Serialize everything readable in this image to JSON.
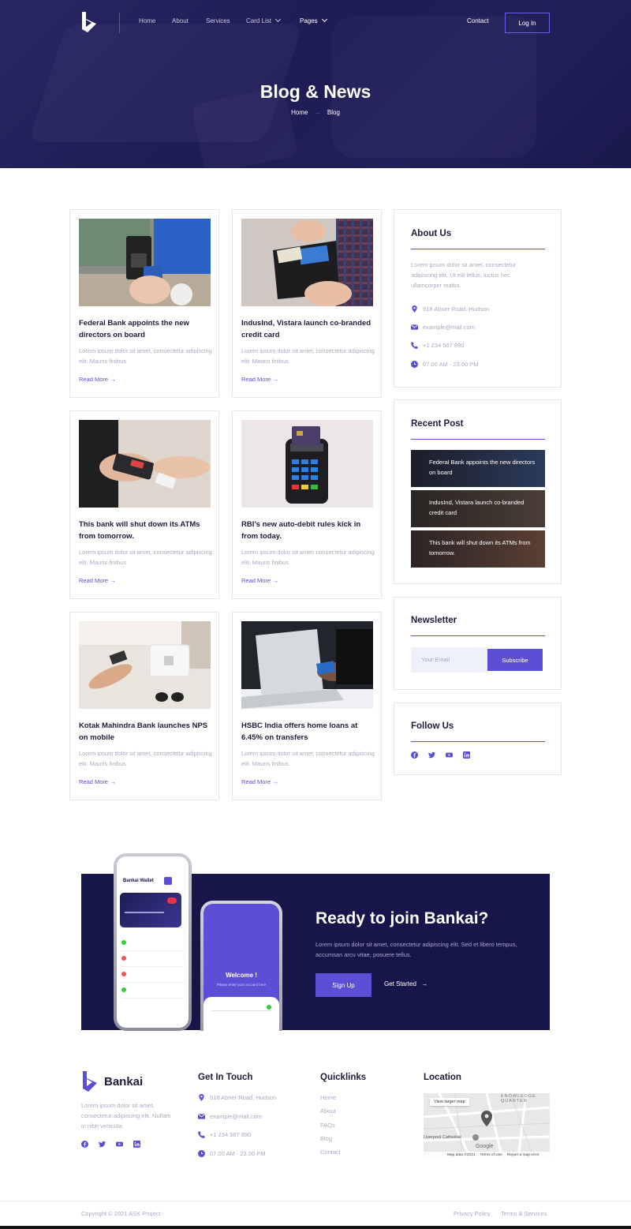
{
  "brand": {
    "name": "Bankai",
    "accent": "#5b4fd6",
    "dark": "#17164a"
  },
  "nav": {
    "items": [
      {
        "label": "Home"
      },
      {
        "label": "About"
      },
      {
        "label": "Services"
      },
      {
        "label": "Card List"
      },
      {
        "label": "Pages"
      }
    ],
    "contact": "Contact",
    "login": "Log In"
  },
  "hero": {
    "title": "Blog & News",
    "crumb_home": "Home",
    "crumb_current": "Blog"
  },
  "posts": [
    {
      "title": "Federal Bank appoints the new directors on board",
      "excerpt": "Lorem ipsum dolor sit amet, consectetur adipiscing elit. Mauris finibus",
      "link": "Read More"
    },
    {
      "title": "IndusInd, Vistara launch co-branded credit card",
      "excerpt": "Lorem ipsum dolor sit amet, consectetur adipiscing elit. Mauris finibus",
      "link": "Read More"
    },
    {
      "title": "This bank will shut down its ATMs from tomorrow.",
      "excerpt": "Lorem ipsum dolor sit amet, consectetur adipiscing elit. Mauris finibus",
      "link": "Read More"
    },
    {
      "title": "RBI’s new auto-debit rules kick in from today.",
      "excerpt": "Lorem ipsum dolor sit amet, consectetur adipiscing elit. Mauris finibus",
      "link": "Read More"
    },
    {
      "title": "Kotak Mahindra Bank launches NPS on mobile",
      "excerpt": "Lorem ipsum dolor sit amet, consectetur adipiscing elit. Mauris finibus",
      "link": "Read More"
    },
    {
      "title": "HSBC India offers home loans at 6.45% on transfers",
      "excerpt": "Lorem ipsum dolor sit amet, consectetur adipiscing elit. Mauris finibus",
      "link": "Read More"
    }
  ],
  "about": {
    "title": "About Us",
    "text": "Lorem ipsum dolor sit amet, consectetur adipiscing elit. Ut elit tellus, luctus nec ullamcorper mattis.",
    "address": "918 Abner Road, Hudson",
    "email": "example@mail.com",
    "phone": "+1 234 567 890",
    "hours": "07.00 AM - 23.00 PM"
  },
  "recent": {
    "title": "Recent Post",
    "items": [
      {
        "text": "Federal Bank appoints the new directors on board"
      },
      {
        "text": "IndusInd, Vistara launch co-branded credit card"
      },
      {
        "text": "This bank will shut down its ATMs from tomorrow."
      }
    ]
  },
  "newsletter": {
    "title": "Newsletter",
    "placeholder": "Your Email",
    "button": "Subscribe"
  },
  "follow": {
    "title": "Follow Us",
    "icons": [
      "facebook-icon",
      "twitter-icon",
      "youtube-icon",
      "linkedin-icon"
    ]
  },
  "cta": {
    "title": "Ready to join Bankai?",
    "text": "Lorem ipsum dolor sit amet, consectetur adipiscing elit. Sed et libero tempus, accumsan arcu vitae, posuere tellus.",
    "signup": "Sign Up",
    "get_started": "Get Started",
    "phone_app_title": "Bankai Wallet",
    "phone_welcome": "Welcome !",
    "phone_welcome_sub": "Please enter your account here"
  },
  "footer": {
    "about_text": "Lorem ipsum dolor sit amet, consectetur adipiscing elit. Nullam in nibh vehicula.",
    "get_in_touch": {
      "title": "Get In Touch",
      "address": "918 Abner Road, Hudson",
      "email": "example@mail.com",
      "phone": "+1 234 567 890",
      "hours": "07.00 AM - 23.00 PM"
    },
    "quicklinks": {
      "title": "Quicklinks",
      "links": [
        "Home",
        "About",
        "FAQs",
        "Blog",
        "Contact"
      ]
    },
    "location": {
      "title": "Location",
      "view_larger": "View larger map",
      "district": "QUARTER",
      "district_top": "KNOWLEDGE",
      "cathedral": "Liverpool Cathedral",
      "credits": "Map data ©2021",
      "terms": "Terms of Use",
      "report": "Report a map error",
      "google": "Google"
    },
    "copyright": "Copyright © 2021 ASK Project",
    "privacy": "Privacy Policy",
    "terms": "Terms & Services"
  }
}
